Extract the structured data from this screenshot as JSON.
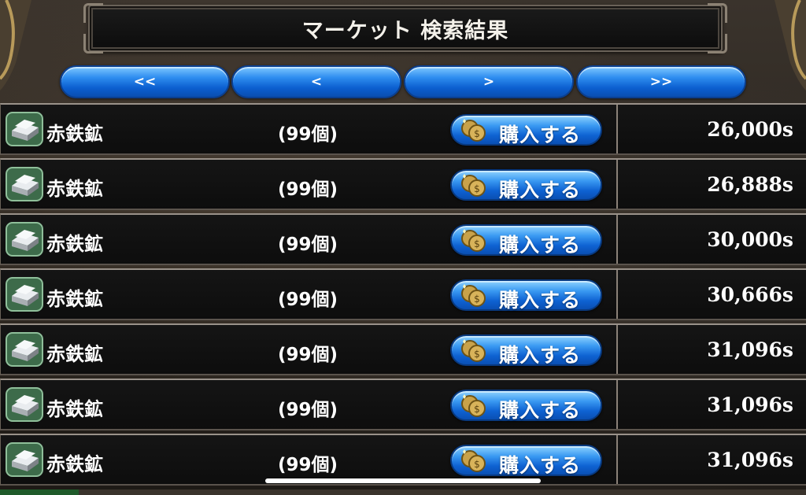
{
  "title": "マーケット 検索結果",
  "pager": {
    "first": "<<",
    "prev": "<",
    "next": ">",
    "last": ">>"
  },
  "buy_label": "購入する",
  "rows": [
    {
      "name": "赤鉄鉱",
      "qty": "(99個)",
      "price": "26,000s"
    },
    {
      "name": "赤鉄鉱",
      "qty": "(99個)",
      "price": "26,888s"
    },
    {
      "name": "赤鉄鉱",
      "qty": "(99個)",
      "price": "30,000s"
    },
    {
      "name": "赤鉄鉱",
      "qty": "(99個)",
      "price": "30,666s"
    },
    {
      "name": "赤鉄鉱",
      "qty": "(99個)",
      "price": "31,096s"
    },
    {
      "name": "赤鉄鉱",
      "qty": "(99個)",
      "price": "31,096s"
    },
    {
      "name": "赤鉄鉱",
      "qty": "(99個)",
      "price": "31,096s"
    }
  ],
  "icons": {
    "item": "ingot-icon",
    "coin": "coin-icon"
  },
  "colors": {
    "button_blue": "#1f7fe8",
    "row_bg": "#111111",
    "text": "#ffffff"
  }
}
